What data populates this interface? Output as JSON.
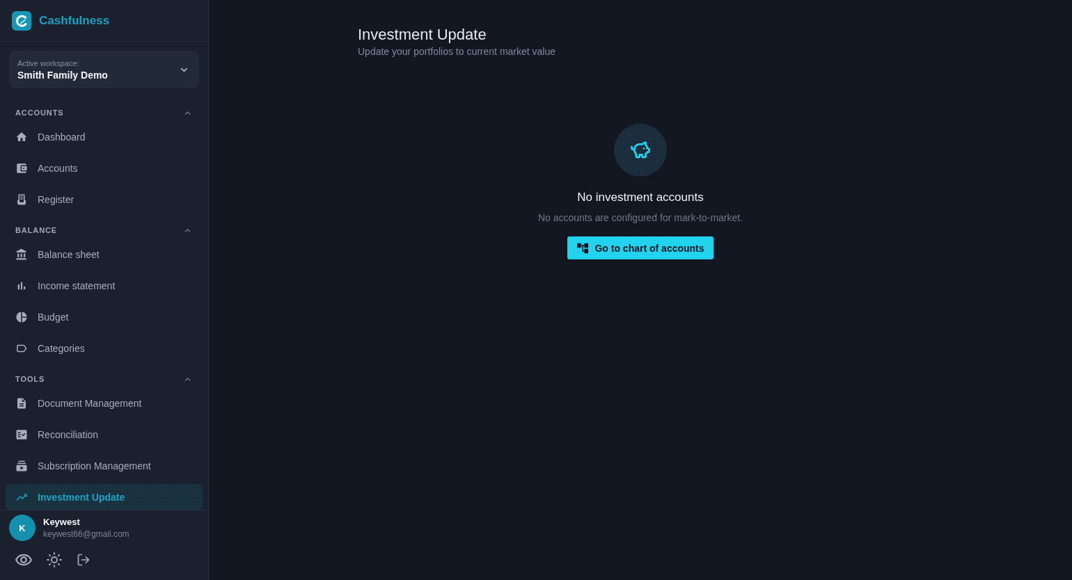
{
  "sidebar": {
    "brand": "Cashfulness",
    "workspace": {
      "label": "Active workspace:",
      "name": "Smith Family Demo"
    },
    "sections": [
      {
        "title": "ACCOUNTS",
        "expanded": true,
        "items": [
          {
            "label": "Dashboard",
            "selected": false
          },
          {
            "label": "Accounts",
            "selected": false
          },
          {
            "label": "Register",
            "selected": false
          }
        ]
      },
      {
        "title": "BALANCE",
        "expanded": true,
        "items": [
          {
            "label": "Balance sheet",
            "selected": false
          },
          {
            "label": "Income statement",
            "selected": false
          },
          {
            "label": "Budget",
            "selected": false
          },
          {
            "label": "Categories",
            "selected": false
          }
        ]
      },
      {
        "title": "TOOLS",
        "expanded": true,
        "items": [
          {
            "label": "Document Management",
            "selected": false
          },
          {
            "label": "Reconciliation",
            "selected": false
          },
          {
            "label": "Subscription Management",
            "selected": false
          },
          {
            "label": "Investment Update",
            "selected": true
          }
        ]
      }
    ],
    "user": {
      "initial": "K",
      "name": "Keywest",
      "email": "keywest66@gmail.com"
    }
  },
  "main": {
    "title": "Investment Update",
    "subtitle": "Update your portfolios to current market value",
    "empty_state": {
      "title": "No investment accounts",
      "message": "No accounts are configured for mark-to-market.",
      "button": "Go to chart of accounts"
    }
  }
}
